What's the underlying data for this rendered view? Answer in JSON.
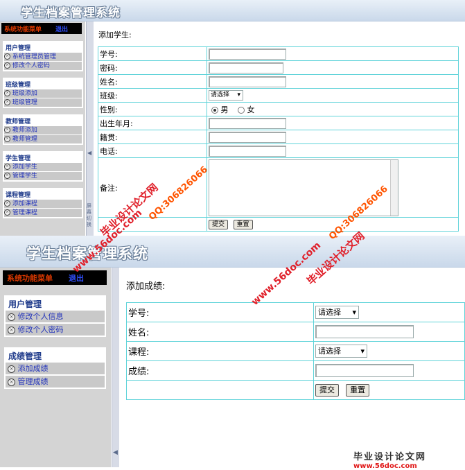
{
  "app_title": "学生档案管理系统",
  "top_panel": {
    "sidebar": {
      "menu_label": "系统功能菜单",
      "exit_label": "退出",
      "groups": [
        {
          "title": "用户管理",
          "items": [
            "系统管理员管理",
            "修改个人密码"
          ]
        },
        {
          "title": "班级管理",
          "items": [
            "班级添加",
            "班级管理"
          ]
        },
        {
          "title": "教师管理",
          "items": [
            "教师添加",
            "教师管理"
          ]
        },
        {
          "title": "学生管理",
          "items": [
            "添加学生",
            "管理学生"
          ]
        },
        {
          "title": "课程管理",
          "items": [
            "添加课程",
            "管理课程"
          ]
        }
      ]
    },
    "splitter_text": "屏幕切换",
    "form": {
      "heading": "添加学生:",
      "labels": {
        "student_no": "学号:",
        "password": "密码:",
        "name": "姓名:",
        "class": "班级:",
        "gender": "性别:",
        "birth": "出生年月:",
        "origin": "籍贯:",
        "phone": "电话:",
        "remark": "备注:"
      },
      "class_select": "请选择",
      "gender_male": "男",
      "gender_female": "女",
      "submit": "提交",
      "reset": "重置"
    }
  },
  "bottom_panel": {
    "sidebar": {
      "menu_label": "系统功能菜单",
      "exit_label": "退出",
      "groups": [
        {
          "title": "用户管理",
          "items": [
            "修改个人信息",
            "修改个人密码"
          ]
        },
        {
          "title": "成绩管理",
          "items": [
            "添加成绩",
            "管理成绩"
          ]
        }
      ]
    },
    "form": {
      "heading": "添加成绩:",
      "labels": {
        "student_no": "学号:",
        "name": "姓名:",
        "course": "课程:",
        "score": "成绩:"
      },
      "student_select": "请选择",
      "course_select": "请选择",
      "submit": "提交",
      "reset": "重置"
    }
  },
  "watermarks": {
    "site_cn": "毕业设计论文网",
    "qq": "QQ:306826066",
    "site_url": "www.56doc.com"
  },
  "colors": {
    "title_bg": "#c9d8ea",
    "sidebar_bg": "#d4d4d4",
    "menu_red": "#e03a00",
    "exit_blue": "#2f4fff",
    "table_border": "#5fd3d9",
    "link_blue": "#2233bb"
  }
}
